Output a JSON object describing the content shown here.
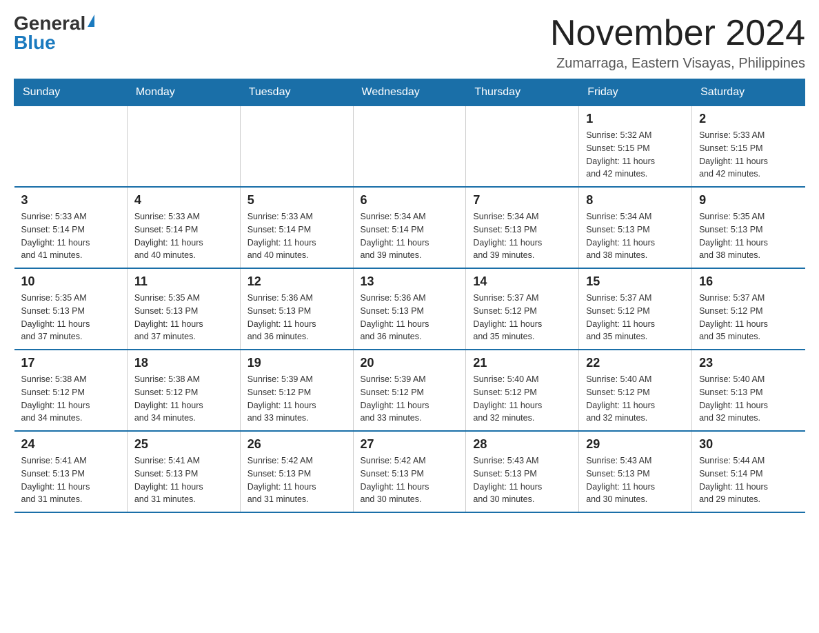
{
  "header": {
    "logo_general": "General",
    "logo_blue": "Blue",
    "month_title": "November 2024",
    "location": "Zumarraga, Eastern Visayas, Philippines"
  },
  "days_of_week": [
    "Sunday",
    "Monday",
    "Tuesday",
    "Wednesday",
    "Thursday",
    "Friday",
    "Saturday"
  ],
  "weeks": [
    [
      {
        "day": "",
        "info": ""
      },
      {
        "day": "",
        "info": ""
      },
      {
        "day": "",
        "info": ""
      },
      {
        "day": "",
        "info": ""
      },
      {
        "day": "",
        "info": ""
      },
      {
        "day": "1",
        "info": "Sunrise: 5:32 AM\nSunset: 5:15 PM\nDaylight: 11 hours\nand 42 minutes."
      },
      {
        "day": "2",
        "info": "Sunrise: 5:33 AM\nSunset: 5:15 PM\nDaylight: 11 hours\nand 42 minutes."
      }
    ],
    [
      {
        "day": "3",
        "info": "Sunrise: 5:33 AM\nSunset: 5:14 PM\nDaylight: 11 hours\nand 41 minutes."
      },
      {
        "day": "4",
        "info": "Sunrise: 5:33 AM\nSunset: 5:14 PM\nDaylight: 11 hours\nand 40 minutes."
      },
      {
        "day": "5",
        "info": "Sunrise: 5:33 AM\nSunset: 5:14 PM\nDaylight: 11 hours\nand 40 minutes."
      },
      {
        "day": "6",
        "info": "Sunrise: 5:34 AM\nSunset: 5:14 PM\nDaylight: 11 hours\nand 39 minutes."
      },
      {
        "day": "7",
        "info": "Sunrise: 5:34 AM\nSunset: 5:13 PM\nDaylight: 11 hours\nand 39 minutes."
      },
      {
        "day": "8",
        "info": "Sunrise: 5:34 AM\nSunset: 5:13 PM\nDaylight: 11 hours\nand 38 minutes."
      },
      {
        "day": "9",
        "info": "Sunrise: 5:35 AM\nSunset: 5:13 PM\nDaylight: 11 hours\nand 38 minutes."
      }
    ],
    [
      {
        "day": "10",
        "info": "Sunrise: 5:35 AM\nSunset: 5:13 PM\nDaylight: 11 hours\nand 37 minutes."
      },
      {
        "day": "11",
        "info": "Sunrise: 5:35 AM\nSunset: 5:13 PM\nDaylight: 11 hours\nand 37 minutes."
      },
      {
        "day": "12",
        "info": "Sunrise: 5:36 AM\nSunset: 5:13 PM\nDaylight: 11 hours\nand 36 minutes."
      },
      {
        "day": "13",
        "info": "Sunrise: 5:36 AM\nSunset: 5:13 PM\nDaylight: 11 hours\nand 36 minutes."
      },
      {
        "day": "14",
        "info": "Sunrise: 5:37 AM\nSunset: 5:12 PM\nDaylight: 11 hours\nand 35 minutes."
      },
      {
        "day": "15",
        "info": "Sunrise: 5:37 AM\nSunset: 5:12 PM\nDaylight: 11 hours\nand 35 minutes."
      },
      {
        "day": "16",
        "info": "Sunrise: 5:37 AM\nSunset: 5:12 PM\nDaylight: 11 hours\nand 35 minutes."
      }
    ],
    [
      {
        "day": "17",
        "info": "Sunrise: 5:38 AM\nSunset: 5:12 PM\nDaylight: 11 hours\nand 34 minutes."
      },
      {
        "day": "18",
        "info": "Sunrise: 5:38 AM\nSunset: 5:12 PM\nDaylight: 11 hours\nand 34 minutes."
      },
      {
        "day": "19",
        "info": "Sunrise: 5:39 AM\nSunset: 5:12 PM\nDaylight: 11 hours\nand 33 minutes."
      },
      {
        "day": "20",
        "info": "Sunrise: 5:39 AM\nSunset: 5:12 PM\nDaylight: 11 hours\nand 33 minutes."
      },
      {
        "day": "21",
        "info": "Sunrise: 5:40 AM\nSunset: 5:12 PM\nDaylight: 11 hours\nand 32 minutes."
      },
      {
        "day": "22",
        "info": "Sunrise: 5:40 AM\nSunset: 5:12 PM\nDaylight: 11 hours\nand 32 minutes."
      },
      {
        "day": "23",
        "info": "Sunrise: 5:40 AM\nSunset: 5:13 PM\nDaylight: 11 hours\nand 32 minutes."
      }
    ],
    [
      {
        "day": "24",
        "info": "Sunrise: 5:41 AM\nSunset: 5:13 PM\nDaylight: 11 hours\nand 31 minutes."
      },
      {
        "day": "25",
        "info": "Sunrise: 5:41 AM\nSunset: 5:13 PM\nDaylight: 11 hours\nand 31 minutes."
      },
      {
        "day": "26",
        "info": "Sunrise: 5:42 AM\nSunset: 5:13 PM\nDaylight: 11 hours\nand 31 minutes."
      },
      {
        "day": "27",
        "info": "Sunrise: 5:42 AM\nSunset: 5:13 PM\nDaylight: 11 hours\nand 30 minutes."
      },
      {
        "day": "28",
        "info": "Sunrise: 5:43 AM\nSunset: 5:13 PM\nDaylight: 11 hours\nand 30 minutes."
      },
      {
        "day": "29",
        "info": "Sunrise: 5:43 AM\nSunset: 5:13 PM\nDaylight: 11 hours\nand 30 minutes."
      },
      {
        "day": "30",
        "info": "Sunrise: 5:44 AM\nSunset: 5:14 PM\nDaylight: 11 hours\nand 29 minutes."
      }
    ]
  ]
}
